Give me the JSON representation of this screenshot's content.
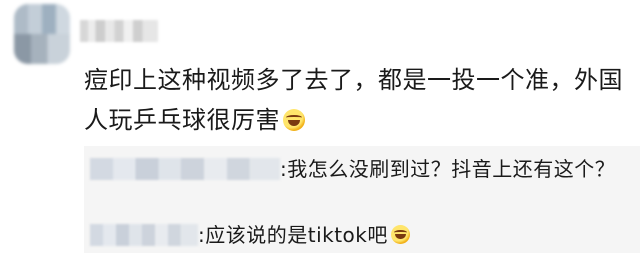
{
  "comment": {
    "text": "痘印上这种视频多了去了，都是一投一个准，外国人玩乒乓球很厉害",
    "emoji": "laughing-tears-emoji"
  },
  "replies": [
    {
      "text": ":我怎么没刷到过？抖音上还有这个？"
    },
    {
      "text": ":应该说的是tiktok吧",
      "emoji": "laughing-tears-emoji"
    }
  ]
}
